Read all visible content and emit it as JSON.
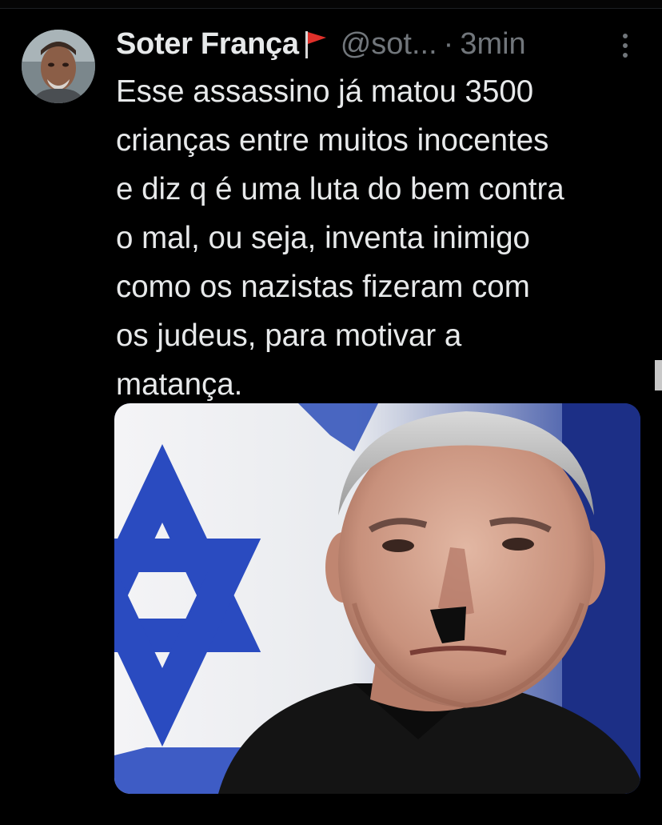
{
  "tweet": {
    "author": {
      "display_name": "Soter França",
      "handle": "@sot...",
      "avatar_icon": "user-avatar",
      "badge_icon": "red-flag-icon"
    },
    "separator": "·",
    "timestamp": "3min",
    "more_icon": "more-vertical-icon",
    "text": "Esse assassino já matou 3500\ncrianças entre muitos inocentes\ne diz q é uma luta do bem contra\no mal, ou seja, inventa inimigo\ncomo os nazistas fizeram com\nos judeus, para motivar a\nmatança.",
    "media": {
      "type": "photo"
    }
  },
  "colors": {
    "background": "#000000",
    "text_primary": "#e7e9ea",
    "text_secondary": "#71767b",
    "flag_red": "#e0302a",
    "flag_blue": "#1e47c8"
  }
}
